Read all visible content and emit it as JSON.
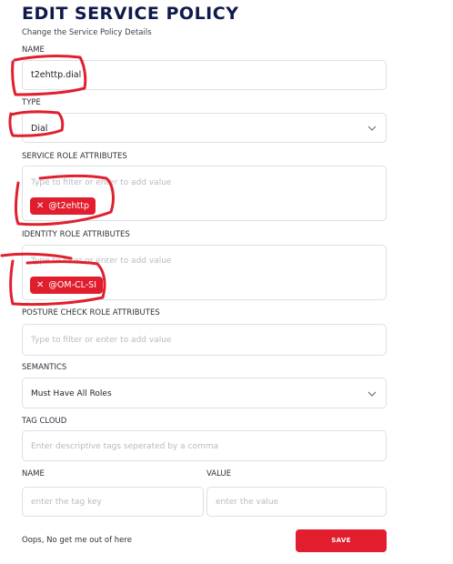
{
  "header": {
    "title": "EDIT SERVICE POLICY",
    "subtitle": "Change the Service Policy Details"
  },
  "form": {
    "name": {
      "label": "NAME",
      "value": "t2ehttp.dial"
    },
    "type": {
      "label": "TYPE",
      "value": "Dial"
    },
    "service_roles": {
      "label": "SERVICE ROLE ATTRIBUTES",
      "placeholder": "Type to filter or enter to add value",
      "tags": [
        "@t2ehttp"
      ]
    },
    "identity_roles": {
      "label": "IDENTITY ROLE ATTRIBUTES",
      "placeholder": "Type to filter or enter to add value",
      "tags": [
        "@OM-CL-SI"
      ]
    },
    "posture_roles": {
      "label": "POSTURE CHECK ROLE ATTRIBUTES",
      "placeholder": "Type to filter or enter to add value"
    },
    "semantics": {
      "label": "SEMANTICS",
      "value": "Must Have All Roles"
    },
    "tag_cloud": {
      "label": "TAG CLOUD",
      "placeholder": "Enter descriptive tags seperated by a comma"
    },
    "tag_name": {
      "label": "NAME",
      "placeholder": "enter the tag key"
    },
    "tag_value": {
      "label": "VALUE",
      "placeholder": "enter the value"
    }
  },
  "actions": {
    "cancel_label": "Oops, No get me out of here",
    "save_label": "SAVE"
  },
  "colors": {
    "title": "#0f1a4a",
    "accent": "#e11d2e",
    "annotation": "#e0202e"
  },
  "icons": {
    "dropdown": "chevron-down-icon",
    "tag_remove": "close-icon"
  }
}
